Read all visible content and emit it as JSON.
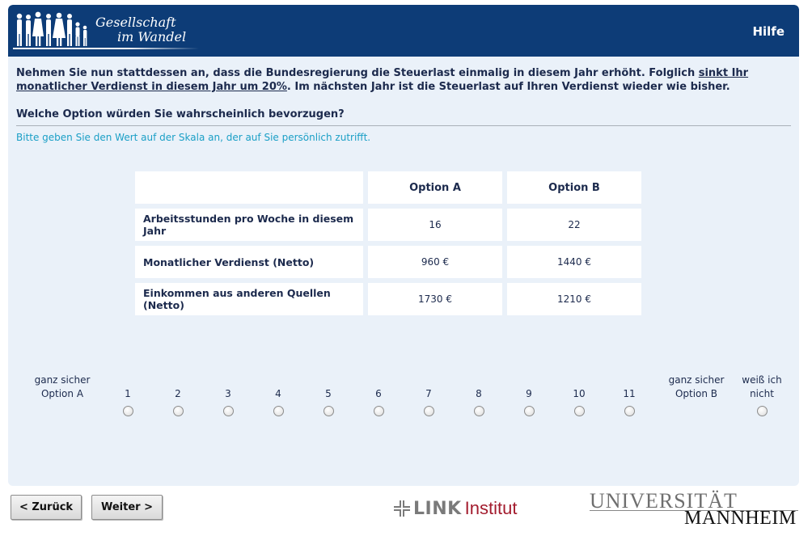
{
  "header": {
    "logo_line1": "Gesellschaft",
    "logo_line2": "im Wandel",
    "help_label": "Hilfe",
    "brand_color": "#0d3c77"
  },
  "intro": {
    "part1": "Nehmen Sie nun stattdessen an, dass die Bundesregierung die Steuerlast einmalig in diesem Jahr erhöht. Folglich ",
    "underlined": "sinkt Ihr monatlicher Verdienst in diesem Jahr um 20%",
    "part2": ". Im nächsten Jahr ist die Steuerlast auf Ihren Verdienst wieder wie bisher."
  },
  "question": "Welche Option würden Sie wahrscheinlich bevorzugen?",
  "instruction": "Bitte geben Sie den Wert auf der Skala an, der auf Sie persönlich zutrifft.",
  "options_table": {
    "headers": [
      "",
      "Option A",
      "Option B"
    ],
    "rows": [
      {
        "label": "Arbeitsstunden pro Woche in diesem Jahr",
        "a": "16",
        "b": "22"
      },
      {
        "label": "Monatlicher Verdienst (Netto)",
        "a": "960 €",
        "b": "1440 €"
      },
      {
        "label": "Einkommen aus anderen Quellen (Netto)",
        "a": "1730 €",
        "b": "1210 €"
      }
    ]
  },
  "scale": {
    "left_anchor": [
      "ganz sicher",
      "Option A"
    ],
    "right_anchor": [
      "ganz sicher",
      "Option B"
    ],
    "dont_know": [
      "weiß ich",
      "nicht"
    ],
    "points": [
      "1",
      "2",
      "3",
      "4",
      "5",
      "6",
      "7",
      "8",
      "9",
      "10",
      "11"
    ]
  },
  "nav": {
    "back_label": "< Zurück",
    "next_label": "Weiter >"
  },
  "footer": {
    "link_logo_text": "LINK",
    "link_logo_suffix": "Institut",
    "uni_line1": "UNIVERSITÄT",
    "uni_line2": "MANNHEIM"
  }
}
